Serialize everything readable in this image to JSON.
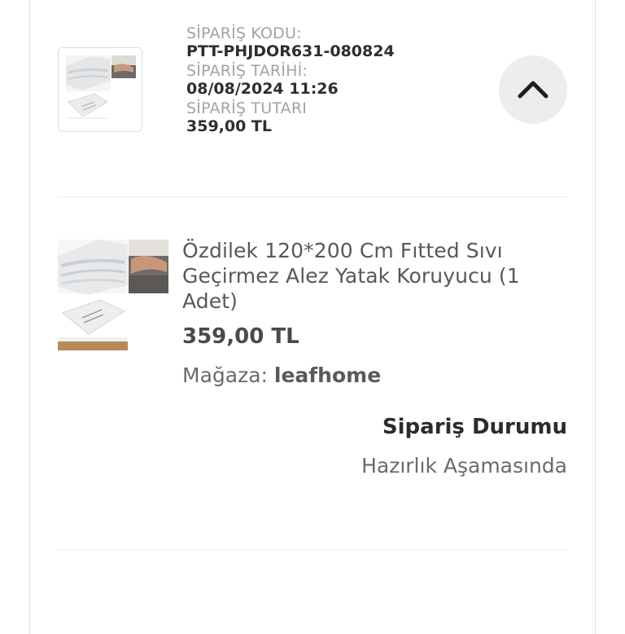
{
  "order": {
    "code_label": "SİPARİŞ KODU:",
    "code_value": "PTT-PHJDOR631-080824",
    "date_label": "SİPARİŞ TARİHİ:",
    "date_value": "08/08/2024 11:26",
    "amount_label": "SİPARİŞ TUTARI",
    "amount_value": "359,00 TL",
    "toggle_icon": "chevron-up-icon"
  },
  "product": {
    "title": "Özdilek 120*200 Cm Fıtted Sıvı Geçirmez Alez Yatak Koruyucu (1 Adet)",
    "price": "359,00 TL",
    "store_label": "Mağaza:",
    "store_name": "leafhome",
    "image_icon": "mattress-protector-photo"
  },
  "status": {
    "title": "Sipariş Durumu",
    "value": "Hazırlık Aşamasında"
  }
}
